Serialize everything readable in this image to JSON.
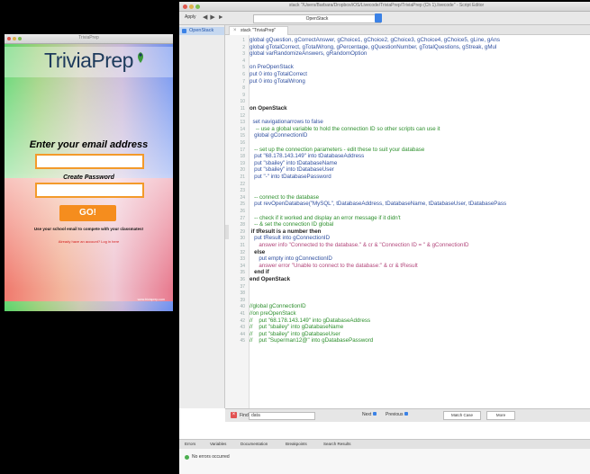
{
  "simulator": {
    "window_title": "TriviaPrep",
    "logo": "TriviaPrep",
    "email_label": "Enter your email address",
    "email_value": "",
    "password_label": "Create Password",
    "password_value": "",
    "go_button": "GO!",
    "school_note": "Use your school email to compete with your classmates!",
    "no_account_link": "Already have an account? Log in here",
    "footer_note": "www.triviaprep.com"
  },
  "editor": {
    "window_title": "stack \"/Users/Barbara/Dropbox/iOS/Livecode/TriviaPrep/TriviaPrep (Ch 1).livecode\" - Script Editor",
    "toolbar": {
      "apply_label": "Apply",
      "handler_select": "OpenStack"
    },
    "sidebar": {
      "items": [
        {
          "label": "OpenStack"
        }
      ]
    },
    "tab": {
      "label": "stack \"TriviaPrep\""
    },
    "code_lines": [
      {
        "n": "1",
        "text": "global gQuestion, gCorrectAnswer, gChoice1, gChoice2, gChoice3, gChoice4, gChoice5, gLine, gAns",
        "cls": "kw"
      },
      {
        "n": "2",
        "text": "global gTotalCorrect, gTotalWrong, gPercentage, gQuestionNumber, gTotalQuestions, gStreak, gMul",
        "cls": "kw"
      },
      {
        "n": "3",
        "text": "global varRandomizeAnswers, gRandomOption",
        "cls": "kw"
      },
      {
        "n": "4",
        "text": "",
        "cls": ""
      },
      {
        "n": "5",
        "text": "on PreOpenStack",
        "cls": "kw"
      },
      {
        "n": "6",
        "text": "put 0 into gTotalCorrect",
        "cls": "kw"
      },
      {
        "n": "7",
        "text": "put 0 into gTotalWrong",
        "cls": "kw"
      },
      {
        "n": "8",
        "text": "",
        "cls": ""
      },
      {
        "n": "9",
        "text": "",
        "cls": ""
      },
      {
        "n": "10",
        "text": "",
        "cls": ""
      },
      {
        "n": "11",
        "text": "on OpenStack",
        "cls": "bk"
      },
      {
        "n": "12",
        "text": "",
        "cls": ""
      },
      {
        "n": "13",
        "text": "  set navigationarrows to false",
        "cls": "kw"
      },
      {
        "n": "14",
        "text": "    -- use a global variable to hold the connection ID so other scripts can use it",
        "cls": "cm"
      },
      {
        "n": "15",
        "text": "   global gConnectionID",
        "cls": "kw"
      },
      {
        "n": "16",
        "text": "",
        "cls": ""
      },
      {
        "n": "17",
        "text": "   -- set up the connection parameters - edit these to suit your database",
        "cls": "cm"
      },
      {
        "n": "18",
        "text": "   put \"68.178.143.149\" into tDatabaseAddress",
        "cls": "kw"
      },
      {
        "n": "19",
        "text": "   put \"sbailey\" into tDatabaseName",
        "cls": "kw"
      },
      {
        "n": "20",
        "text": "   put \"sbailey\" into tDatabaseUser",
        "cls": "kw"
      },
      {
        "n": "21",
        "text": "   put \"-\" into tDatabasePassword",
        "cls": "kw"
      },
      {
        "n": "22",
        "text": "",
        "cls": ""
      },
      {
        "n": "23",
        "text": "",
        "cls": ""
      },
      {
        "n": "24",
        "text": "   -- connect to the database",
        "cls": "cm"
      },
      {
        "n": "25",
        "text": "   put revOpenDatabase(\"MySQL\", tDatabaseAddress, tDatabaseName, tDatabaseUser, tDatabasePass",
        "cls": "kw"
      },
      {
        "n": "26",
        "text": "",
        "cls": ""
      },
      {
        "n": "27",
        "text": "   -- check if it worked and display an error message if it didn't",
        "cls": "cm"
      },
      {
        "n": "28",
        "text": "   -- & set the connection ID global",
        "cls": "cm"
      },
      {
        "n": "29",
        "text": " if tResult is a number then",
        "cls": "bk"
      },
      {
        "n": "30",
        "text": "   put tResult into gConnectionID",
        "cls": "kw"
      },
      {
        "n": "31",
        "text": "      answer info \"Connected to the database.\" & cr & \"Connection ID = \" & gConnectionID",
        "cls": "st"
      },
      {
        "n": "32",
        "text": "   else",
        "cls": "bk"
      },
      {
        "n": "33",
        "text": "      put empty into gConnectionID",
        "cls": "kw"
      },
      {
        "n": "34",
        "text": "      answer error \"Unable to connect to the database:\" & cr & tResult",
        "cls": "st"
      },
      {
        "n": "35",
        "text": "   end if",
        "cls": "bk"
      },
      {
        "n": "36",
        "text": "end OpenStack",
        "cls": "bk"
      },
      {
        "n": "37",
        "text": "",
        "cls": ""
      },
      {
        "n": "38",
        "text": "",
        "cls": ""
      },
      {
        "n": "39",
        "text": "",
        "cls": ""
      },
      {
        "n": "40",
        "text": "//global gConnectionID",
        "cls": "cm"
      },
      {
        "n": "41",
        "text": "//on preOpenStack",
        "cls": "cm"
      },
      {
        "n": "42",
        "text": "//    put \"68.178.143.149\" into gDatabaseAddress",
        "cls": "cm"
      },
      {
        "n": "43",
        "text": "//    put \"sbailey\" into gDatabaseName",
        "cls": "cm"
      },
      {
        "n": "44",
        "text": "//    put \"sbailey\" into gDatabaseUser",
        "cls": "cm"
      },
      {
        "n": "45",
        "text": "//    put \"Superman12@\" into gDatabasePassword",
        "cls": "cm"
      }
    ],
    "findbar": {
      "label": "Find",
      "value": "data",
      "next": "Next",
      "previous": "Previous",
      "match_case": "Match Case",
      "more": "More"
    },
    "bottom_tabs": [
      "Errors",
      "Variables",
      "Documentation",
      "Breakpoints",
      "Search Results"
    ],
    "status": "No errors occurred"
  }
}
